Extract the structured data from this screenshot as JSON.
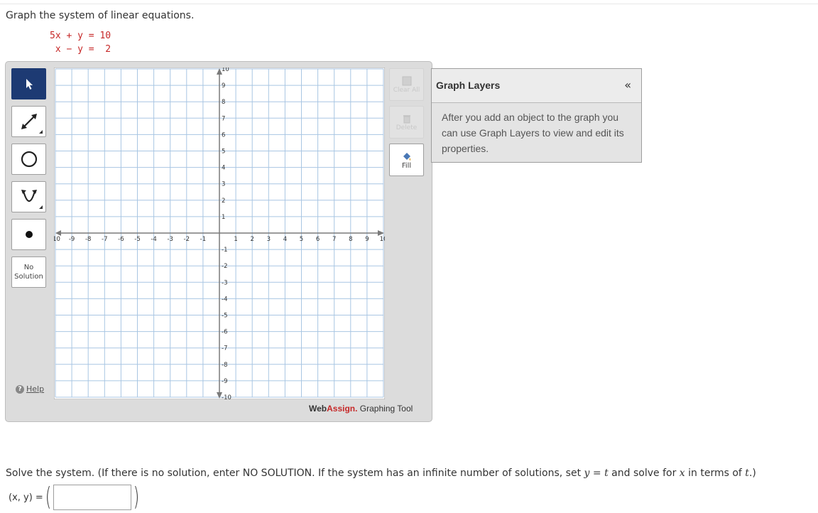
{
  "problem": {
    "prompt": "Graph the system of linear equations.",
    "equations": [
      "5x + y = 10",
      " x − y =  2"
    ]
  },
  "toolbar": {
    "tools": [
      {
        "name": "pointer",
        "icon": "arrow-pointer-icon",
        "selected": true
      },
      {
        "name": "line",
        "icon": "line-tool-icon"
      },
      {
        "name": "circle",
        "icon": "circle-tool-icon"
      },
      {
        "name": "parabola",
        "icon": "parabola-tool-icon"
      },
      {
        "name": "point",
        "icon": "point-tool-icon"
      }
    ],
    "no_solution_line1": "No",
    "no_solution_line2": "Solution",
    "help_label": "Help"
  },
  "actions": {
    "clear_all": "Clear All",
    "delete": "Delete",
    "fill": "Fill"
  },
  "graph": {
    "x_range": [
      -10,
      10
    ],
    "y_range": [
      -10,
      10
    ],
    "x_ticks": [
      "-10",
      "-9",
      "-8",
      "-7",
      "-6",
      "-5",
      "-4",
      "-3",
      "-2",
      "-1",
      "1",
      "2",
      "3",
      "4",
      "5",
      "6",
      "7",
      "8",
      "9",
      "10"
    ],
    "y_ticks": [
      "10",
      "9",
      "8",
      "7",
      "6",
      "5",
      "4",
      "3",
      "2",
      "1",
      "-1",
      "-2",
      "-3",
      "-4",
      "-5",
      "-6",
      "-7",
      "-8",
      "-9",
      "-10"
    ],
    "grid": true,
    "grid_color": "#a9c6e3",
    "axis_color": "#7a7a7a"
  },
  "brand": {
    "web": "Web",
    "assign": "Assign.",
    "tool": " Graphing Tool"
  },
  "layers": {
    "title": "Graph Layers",
    "collapse": "«",
    "description": "After you add an object to the graph you can use Graph Layers to view and edit its properties."
  },
  "solve": {
    "t1": "Solve the system. (If there is no solution, enter NO SOLUTION. If the system has an infinite number of solutions, set ",
    "v_y": "y",
    "t2": " = ",
    "v_t": "t",
    "t3": " and solve for ",
    "v_x": "x",
    "t4": " in terms of ",
    "v_t2": "t",
    "t5": ".)",
    "answer_label": "(x, y) ="
  },
  "colors": {
    "selected_tool": "#1d3a73",
    "equation_red": "#c62828",
    "brand_red": "#c62828"
  }
}
